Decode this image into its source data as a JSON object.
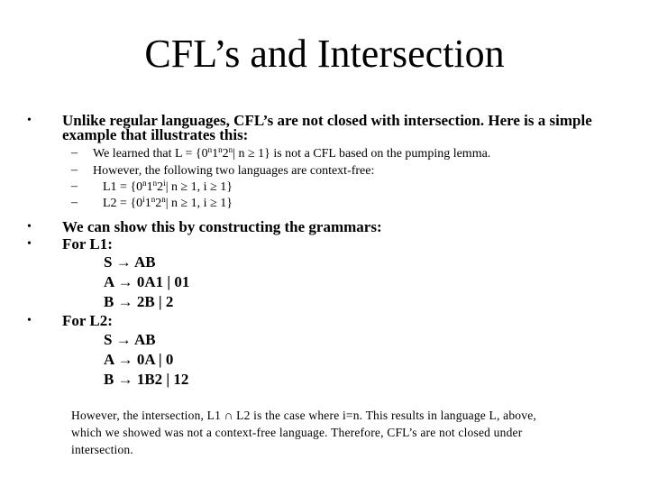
{
  "slide": {
    "title": "CFL’s and Intersection",
    "bullet_glyph": "•",
    "dash_glyph": "–",
    "arrow_glyph": "→",
    "bullets": [
      {
        "line1": "Unlike regular languages, CFL’s are not closed with intersection.  Here is a simple",
        "line2": "example that illustrates this:"
      },
      {
        "text": "We can show this by constructing the grammars:"
      },
      {
        "text": "For L1:"
      },
      {
        "text": "For L2:"
      }
    ],
    "sub_bullets": [
      {
        "pre": "We learned that L = {0",
        "s1": "n",
        "m1": "1",
        "s2": "n",
        "m2": "2",
        "s3": "n",
        "post": "| n ≥ 1}  is not a CFL based on the pumping lemma."
      },
      {
        "text": "However, the following two languages are context-free:"
      },
      {
        "pre": "L1 = {0",
        "s1": "n",
        "m1": "1",
        "s2": "n",
        "m2": "2",
        "s3": "i",
        "post": "| n ≥ 1, i ≥ 1}"
      },
      {
        "pre": "L2 = {0",
        "s1": "i",
        "m1": "1",
        "s2": "n",
        "m2": "2",
        "s3": "n",
        "post": "| n ≥ 1, i ≥ 1}"
      }
    ],
    "grammar_l1": [
      {
        "lhs": "S",
        "rhs": "AB"
      },
      {
        "lhs": "A",
        "rhs": "0A1 | 01"
      },
      {
        "lhs": "B",
        "rhs": "2B | 2"
      }
    ],
    "grammar_l2": [
      {
        "lhs": "S",
        "rhs": "AB"
      },
      {
        "lhs": "A",
        "rhs": "0A | 0"
      },
      {
        "lhs": "B",
        "rhs": "1B2 | 12"
      }
    ],
    "note": {
      "line1": "However, the intersection, L1 ∩ L2 is the case where i=n.  This results in language L, above,",
      "line2": "which we showed was not a context-free language.  Therefore, CFL’s are not closed under",
      "line3": "intersection."
    }
  }
}
